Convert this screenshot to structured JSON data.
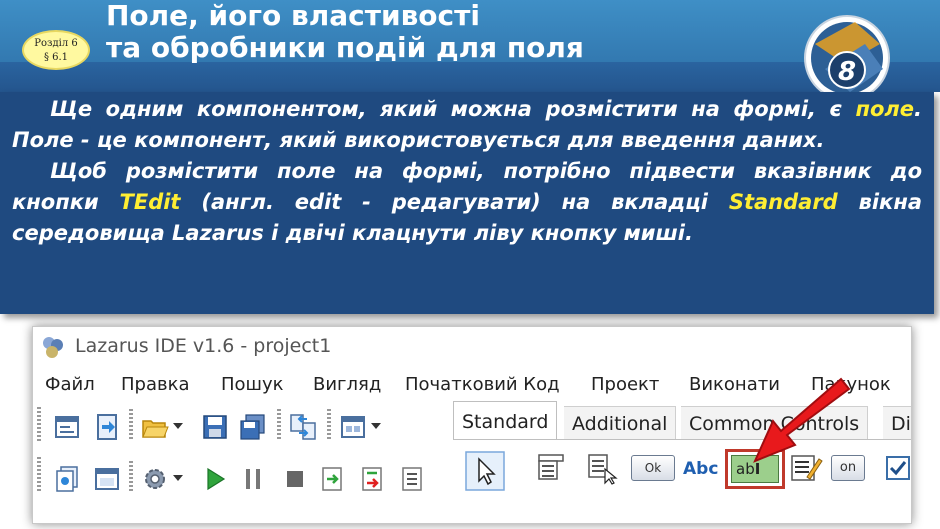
{
  "slide": {
    "title_line1": "Поле, його властивості",
    "title_line2": "та обробники подій для поля",
    "badge_line1": "Розділ 6",
    "badge_line2": "§ 6.1",
    "grade": "8"
  },
  "body": {
    "p1_before": "Ще одним компонентом, який можна розмістити на формі, є ",
    "p1_highlight": "поле",
    "p1_after": ". Поле - це компонент, який використовується для введення даних.",
    "p2_before": "Щоб розмістити поле на формі, потрібно підвести вказівник до кнопки ",
    "p2_highlight1": "TEdit",
    "p2_middle": " (англ. edit - редагувати) на вкладці ",
    "p2_highlight2": "Standard",
    "p2_after": " вікна середовища Lazarus і двічі клацнути ліву кнопку миші."
  },
  "ide": {
    "window_title": "Lazarus IDE v1.6 - project1",
    "menu": [
      "Файл",
      "Правка",
      "Пошук",
      "Вигляд",
      "Початковий Код",
      "Проект",
      "Виконати",
      "Пакунок"
    ],
    "tabs": [
      "Standard",
      "Additional",
      "Common Controls",
      "Di"
    ],
    "active_tab": "Standard",
    "palette": {
      "tbutton_label": "Ok",
      "tlabel_label": "Abc",
      "tedit_label": "ab",
      "ttoggle_label": "on"
    },
    "colors": {
      "highlight_box": "#c0392b",
      "arrow": "#e8191c",
      "tedit_bg": "#9ccf8c"
    },
    "icons": [
      "new-form-icon",
      "open-unit-icon",
      "open-icon",
      "save-icon",
      "save-all-icon",
      "toggle-form-unit-icon",
      "view-forms-icon",
      "view-units-icon",
      "settings-icon",
      "run-icon",
      "pause-icon",
      "stop-icon",
      "step-into-icon",
      "step-over-icon",
      "step-out-icon"
    ]
  }
}
